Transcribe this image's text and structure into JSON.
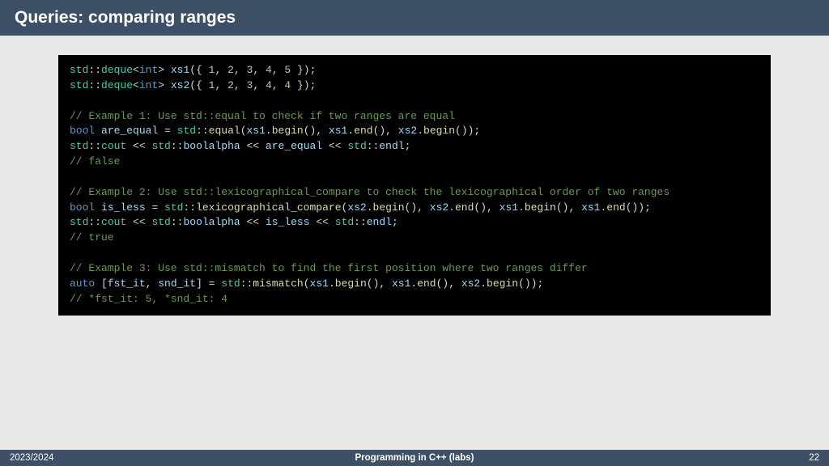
{
  "header": {
    "title": "Queries: comparing ranges"
  },
  "code": {
    "l1": {
      "a": "std",
      "b": "::",
      "c": "deque",
      "d": "<",
      "e": "int",
      "f": "> ",
      "g": "xs1",
      "h": "({ ",
      "i": "1",
      "j": ", ",
      "k": "2",
      "l": ", ",
      "m": "3",
      "n": ", ",
      "o": "4",
      "p": ", ",
      "q": "5",
      "r": " });"
    },
    "l2": {
      "a": "std",
      "b": "::",
      "c": "deque",
      "d": "<",
      "e": "int",
      "f": "> ",
      "g": "xs2",
      "h": "({ ",
      "i": "1",
      "j": ", ",
      "k": "2",
      "l": ", ",
      "m": "3",
      "n": ", ",
      "o": "4",
      "p": ", ",
      "q": "4",
      "r": " });"
    },
    "l4": "// Example 1: Use std::equal to check if two ranges are equal",
    "l5": {
      "a": "bool",
      "b": " ",
      "c": "are_equal",
      "d": " = ",
      "e": "std",
      "f": "::",
      "g": "equal",
      "h": "(",
      "i": "xs1",
      "j": ".",
      "k": "begin",
      "l": "(), ",
      "m": "xs1",
      "n": ".",
      "o": "end",
      "p": "(), ",
      "q": "xs2",
      "r": ".",
      "s": "begin",
      "t": "());"
    },
    "l6": {
      "a": "std",
      "b": "::",
      "c": "cout",
      "d": " << ",
      "e": "std",
      "f": "::",
      "g": "boolalpha",
      "h": " << ",
      "i": "are_equal",
      "j": " << ",
      "k": "std",
      "l": "::",
      "m": "endl",
      "n": ";"
    },
    "l7": "// false",
    "l9": "// Example 2: Use std::lexicographical_compare to check the lexicographical order of two ranges",
    "l10": {
      "a": "bool",
      "b": " ",
      "c": "is_less",
      "d": " = ",
      "e": "std",
      "f": "::",
      "g": "lexicographical_compare",
      "h": "(",
      "i": "xs2",
      "j": ".",
      "k": "begin",
      "l": "(), ",
      "m": "xs2",
      "n": ".",
      "o": "end",
      "p": "(), ",
      "q": "xs1",
      "r": ".",
      "s": "begin",
      "t": "(), ",
      "u": "xs1",
      "v": ".",
      "w": "end",
      "x": "());"
    },
    "l11": {
      "a": "std",
      "b": "::",
      "c": "cout",
      "d": " << ",
      "e": "std",
      "f": "::",
      "g": "boolalpha",
      "h": " << ",
      "i": "is_less",
      "j": " << ",
      "k": "std",
      "l": "::",
      "m": "endl",
      "n": ";"
    },
    "l12": "// true",
    "l14": "// Example 3: Use std::mismatch to find the first position where two ranges differ",
    "l15": {
      "a": "auto",
      "b": " [",
      "c": "fst_it",
      "d": ", ",
      "e": "snd_it",
      "f": "] = ",
      "g": "std",
      "h": "::",
      "i": "mismatch",
      "j": "(",
      "k": "xs1",
      "l": ".",
      "m": "begin",
      "n": "(), ",
      "o": "xs1",
      "p": ".",
      "q": "end",
      "r": "(), ",
      "s": "xs2",
      "t": ".",
      "u": "begin",
      "v": "());"
    },
    "l16": "// *fst_it: 5, *snd_it: 4"
  },
  "footer": {
    "left": "2023/2024",
    "center": "Programming in C++ (labs)",
    "right": "22"
  }
}
